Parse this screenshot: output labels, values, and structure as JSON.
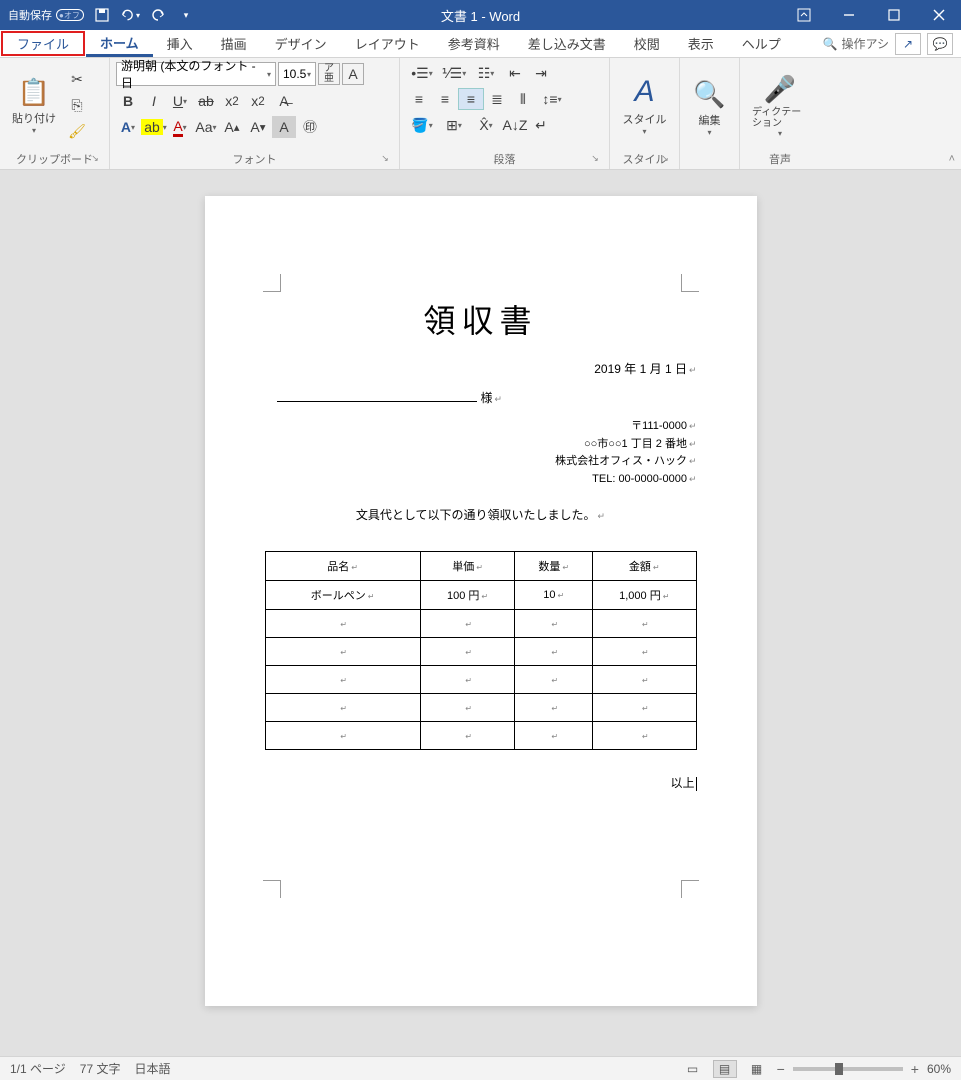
{
  "titlebar": {
    "autosave_label": "自動保存",
    "autosave_state": "オフ",
    "title": "文書 1  -  Word"
  },
  "tabs": {
    "file": "ファイル",
    "home": "ホーム",
    "insert": "挿入",
    "draw": "描画",
    "design": "デザイン",
    "layout": "レイアウト",
    "references": "参考資料",
    "mailings": "差し込み文書",
    "review": "校閲",
    "view": "表示",
    "help": "ヘルプ",
    "tell_me": "操作アシ"
  },
  "ribbon": {
    "clipboard": {
      "label": "クリップボード",
      "paste": "貼り付け"
    },
    "font": {
      "label": "フォント",
      "name": "游明朝 (本文のフォント - 日",
      "size": "10.5"
    },
    "paragraph": {
      "label": "段落"
    },
    "styles": {
      "label": "スタイル",
      "btn": "スタイル"
    },
    "editing": {
      "label": "",
      "btn": "編集"
    },
    "voice": {
      "label": "音声",
      "btn": "ディクテーション"
    }
  },
  "document": {
    "title": "領収書",
    "date": "2019 年 1 月 1 日",
    "recipient_suffix": "様",
    "sender": {
      "postal": "〒111-0000",
      "address": "○○市○○1 丁目 2 番地",
      "company": "株式会社オフィス・ハック",
      "tel": "TEL: 00-0000-0000"
    },
    "note": "文具代として以下の通り領収いたしました。",
    "table": {
      "headers": [
        "品名",
        "単価",
        "数量",
        "金額"
      ],
      "rows": [
        [
          "ボールペン",
          "100 円",
          "10",
          "1,000 円"
        ],
        [
          "",
          "",
          "",
          ""
        ],
        [
          "",
          "",
          "",
          ""
        ],
        [
          "",
          "",
          "",
          ""
        ],
        [
          "",
          "",
          "",
          ""
        ],
        [
          "",
          "",
          "",
          ""
        ]
      ]
    },
    "footer": "以上"
  },
  "statusbar": {
    "page": "1/1 ページ",
    "words": "77 文字",
    "language": "日本語",
    "zoom": "60%"
  }
}
